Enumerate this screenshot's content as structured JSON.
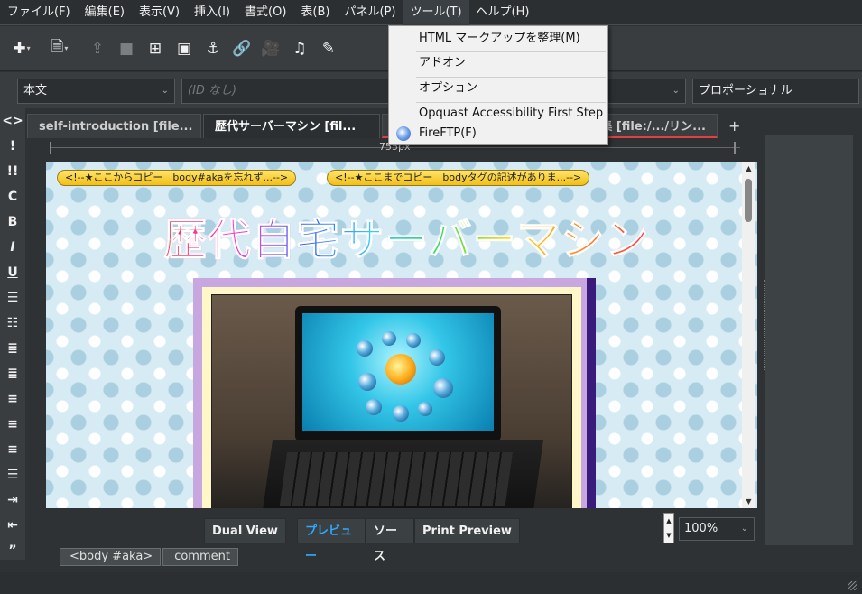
{
  "menubar": {
    "items": [
      "ファイル(F)",
      "編集(E)",
      "表示(V)",
      "挿入(I)",
      "書式(O)",
      "表(B)",
      "パネル(P)",
      "ツール(T)",
      "ヘルプ(H)"
    ]
  },
  "format": {
    "paragraph": "本文",
    "id_placeholder": "(ID なし)",
    "font": "プロポーショナル"
  },
  "left_toolbar": [
    "<>",
    "!",
    "!!",
    "C",
    "B",
    "I",
    "U"
  ],
  "tabs": [
    {
      "label": "self-introduction [file..."
    },
    {
      "label": "歴代サーバーマシン [fil..."
    },
    {
      "label": "ク集 [file:/.../リン..."
    }
  ],
  "tab_add": "+",
  "ruler": {
    "label": "755px"
  },
  "content": {
    "badge_left": "<!--★ここからコピー　body#akaを忘れず...-->",
    "badge_right": "<!--★ここまでコピー　bodyタグの記述がありま...-->",
    "title": "歴代自宅サーバーマシン"
  },
  "bottom": {
    "dual_view": "Dual View",
    "preview": "プレビュー",
    "source": "ソース",
    "print_preview": "Print Preview",
    "zoom": "100%"
  },
  "breadcrumbs": [
    "<body #aka>",
    "comment"
  ],
  "tools_menu": {
    "items": [
      "HTML マークアップを整理(M)",
      "アドオン",
      "オプション",
      "Opquast Accessibility First Step",
      "FireFTP(F)"
    ]
  },
  "colors": {
    "accent": "#2fa9ff",
    "tab_indicator": "#e04040"
  }
}
